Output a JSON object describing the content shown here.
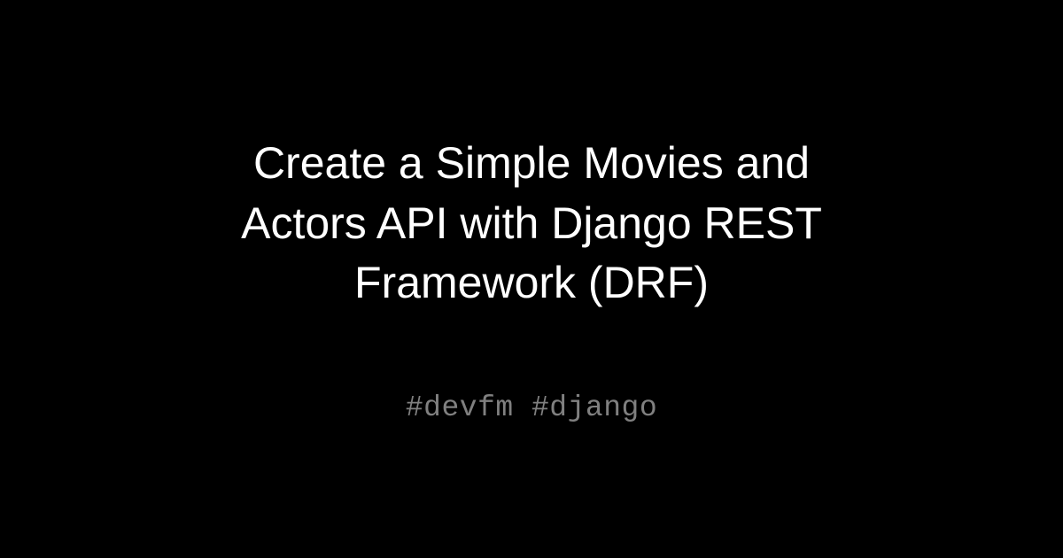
{
  "card": {
    "title": "Create a Simple Movies and Actors API with Django REST Framework (DRF)",
    "tags": "#devfm #django"
  },
  "colors": {
    "background": "#000000",
    "title_text": "#ffffff",
    "tags_text": "#808080"
  }
}
